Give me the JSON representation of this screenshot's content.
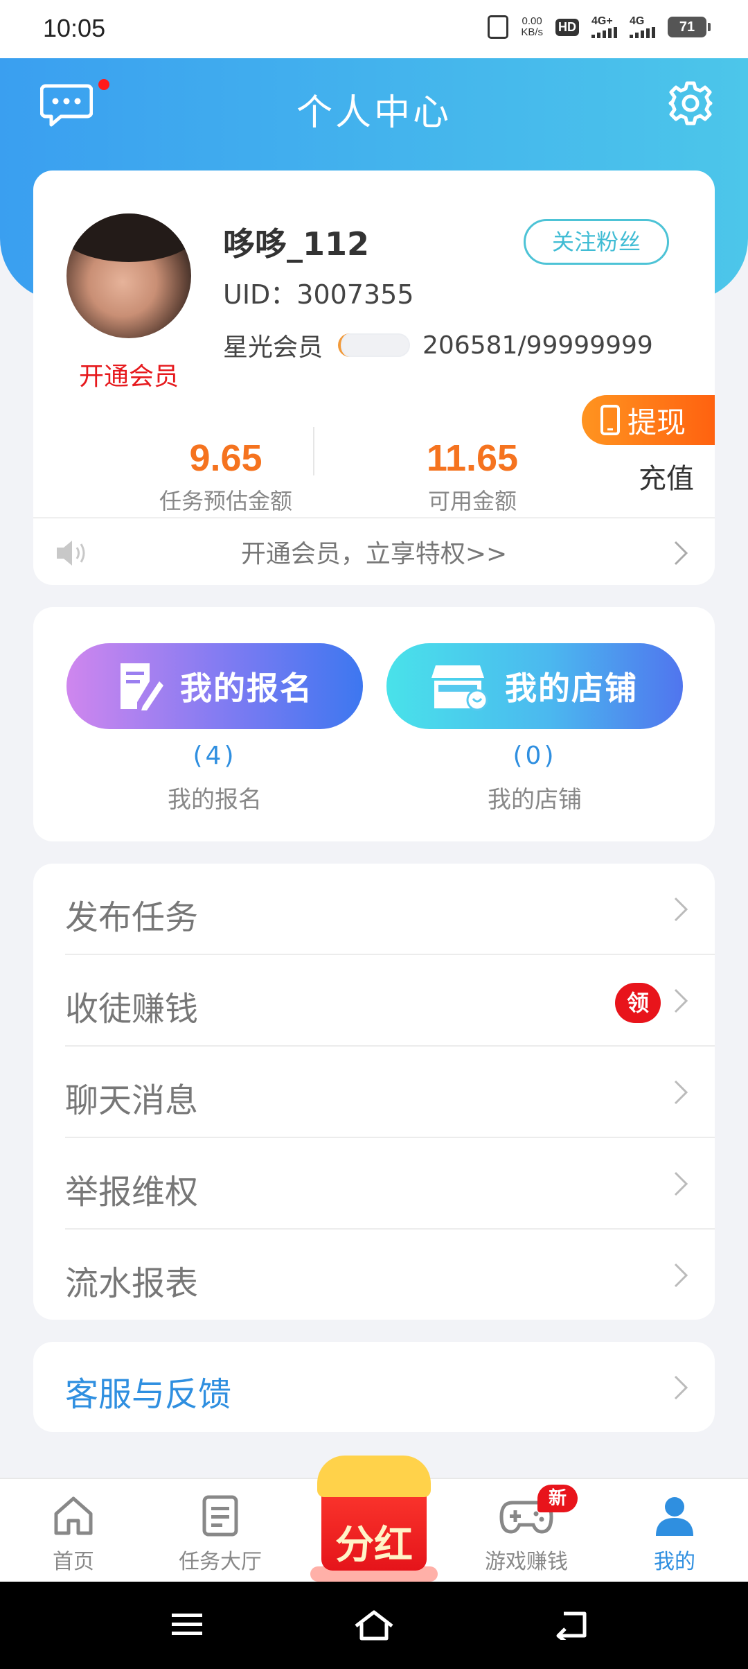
{
  "status_bar": {
    "time": "10:05",
    "net_speed": "0.00",
    "net_unit": "KB/s",
    "hd_label": "HD",
    "sim1_label": "4G+",
    "sim2_label": "4G",
    "battery": "71"
  },
  "header": {
    "title": "个人中心"
  },
  "profile": {
    "username": "哆哆_112",
    "uid": "UID：3007355",
    "follow_label": "关注粉丝",
    "vip_open_label": "开通会员",
    "member_level_label": "星光会员",
    "member_progress_text": "206581/99999999",
    "stats": [
      {
        "value": "9.65",
        "label": "任务预估金额"
      },
      {
        "value": "11.65",
        "label": "可用金额"
      }
    ],
    "withdraw_label": "提现",
    "recharge_label": "充值",
    "notice": "开通会员，立享特权>>"
  },
  "actions": {
    "sign": {
      "label": "我的报名",
      "count": "(4)",
      "sub_label": "我的报名"
    },
    "shop": {
      "label": "我的店铺",
      "count": "(0)",
      "sub_label": "我的店铺"
    }
  },
  "menu": [
    {
      "label": "发布任务"
    },
    {
      "label": "收徒赚钱",
      "badge": "领"
    },
    {
      "label": "聊天消息"
    },
    {
      "label": "举报维权"
    },
    {
      "label": "流水报表"
    }
  ],
  "feedback": {
    "label": "客服与反馈"
  },
  "bottom_nav": {
    "items": [
      {
        "label": "首页",
        "icon": "home-icon"
      },
      {
        "label": "任务大厅",
        "icon": "task-list-icon"
      },
      {
        "label": "分红",
        "icon": "red-envelope-icon"
      },
      {
        "label": "游戏赚钱",
        "icon": "gamepad-icon",
        "badge": "新"
      },
      {
        "label": "我的",
        "icon": "user-icon"
      }
    ],
    "active_index": 4
  },
  "colors": {
    "header_start": "#3a9ff0",
    "header_end": "#4cc6ea",
    "amount": "#f5731f",
    "link_blue": "#2f8fe0",
    "vip_red": "#e6191d",
    "withdraw_orange": "#ff7a18"
  }
}
